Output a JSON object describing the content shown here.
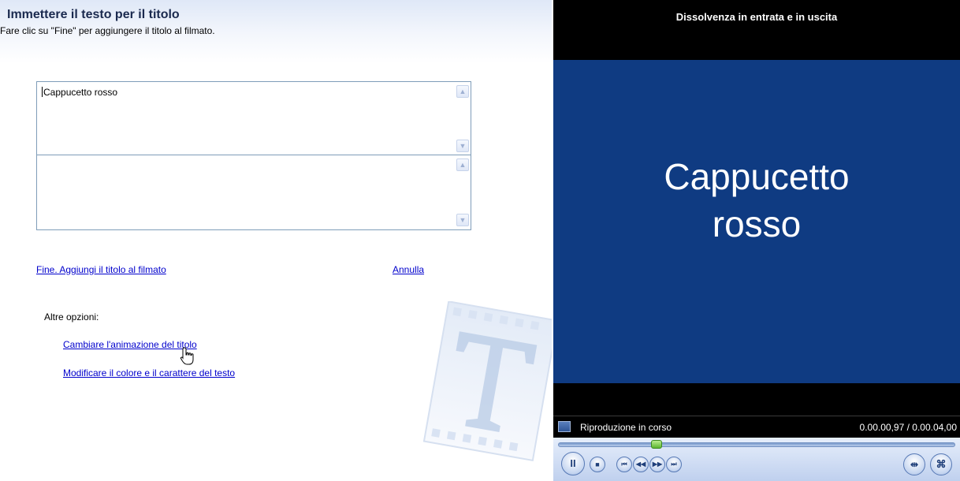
{
  "header": {
    "title": "Immettere il testo per il titolo",
    "subtitle": "Fare clic su \"Fine\" per aggiungere il titolo al filmato."
  },
  "text_boxes": [
    {
      "value": "Cappucetto rosso"
    },
    {
      "value": ""
    }
  ],
  "icons": {
    "scroll_up": "chevron-up-icon",
    "scroll_down": "chevron-down-icon"
  },
  "actions": {
    "done_label": "Fine. Aggiungi il titolo al filmato",
    "cancel_label": "Annulla"
  },
  "more_options": {
    "label": "Altre opzioni:",
    "items": [
      "Cambiare l'animazione del titolo",
      "Modificare il colore e il carattere del testo"
    ]
  },
  "preview": {
    "title": "Dissolvenza in entrata e in uscita",
    "screen_lines": [
      "Cappucetto",
      "rosso"
    ],
    "screen_color": "#0f3b82",
    "status_text": "Riproduzione in corso",
    "time": "0.00.00,97 / 0.00.04,00",
    "progress": 0.24
  },
  "player_controls": {
    "pause": "II",
    "stop": "■",
    "prev": "⏮",
    "rewind": "◀◀",
    "forward": "▶▶",
    "next": "⏭",
    "split": "⇹",
    "snapshot": "⌘"
  },
  "colors": {
    "link": "#0000cc",
    "title": "#1b2a4f"
  }
}
